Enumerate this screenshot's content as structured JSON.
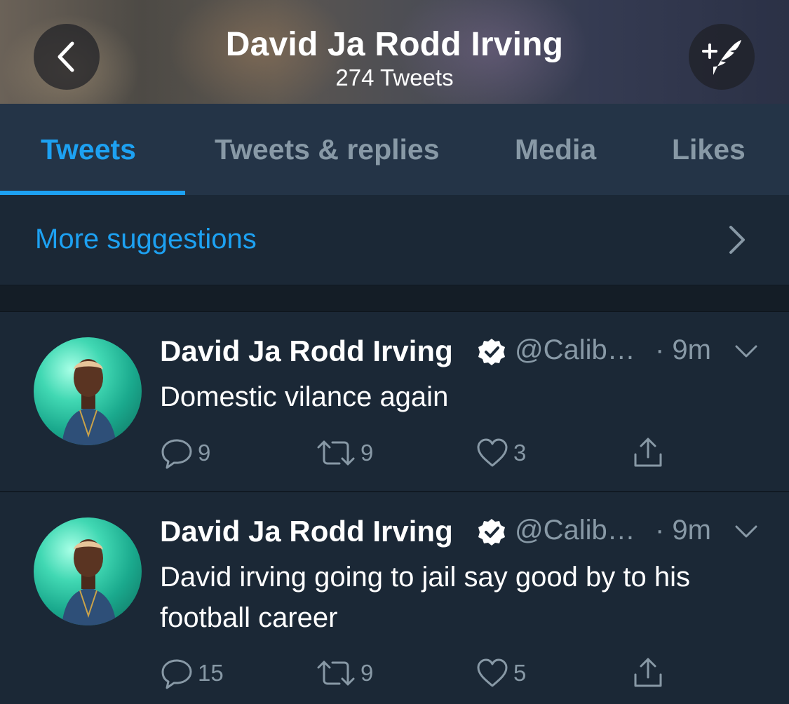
{
  "header": {
    "title": "David Ja Rodd Irving",
    "subtitle": "274 Tweets",
    "back_icon": "chevron-left-icon",
    "compose_icon": "compose-tweet-icon"
  },
  "tabs": [
    {
      "label": "Tweets",
      "active": true
    },
    {
      "label": "Tweets & replies",
      "active": false
    },
    {
      "label": "Media",
      "active": false
    },
    {
      "label": "Likes",
      "active": false
    }
  ],
  "suggestions": {
    "label": "More suggestions"
  },
  "tweets": [
    {
      "name": "David Ja Rodd Irving",
      "handle": "@Calib…",
      "time": "· 9m",
      "text": "Domestic vilance again",
      "replies": "9",
      "retweets": "9",
      "likes": "3"
    },
    {
      "name": "David Ja Rodd Irving",
      "handle": "@Calib…",
      "time": "· 9m",
      "text": "David irving going to jail say good by to his football career",
      "replies": "15",
      "retweets": "9",
      "likes": "5"
    }
  ],
  "colors": {
    "accent": "#1da1f2",
    "background": "#1b2836",
    "tab_bar": "#243447",
    "muted": "#8899a6"
  }
}
